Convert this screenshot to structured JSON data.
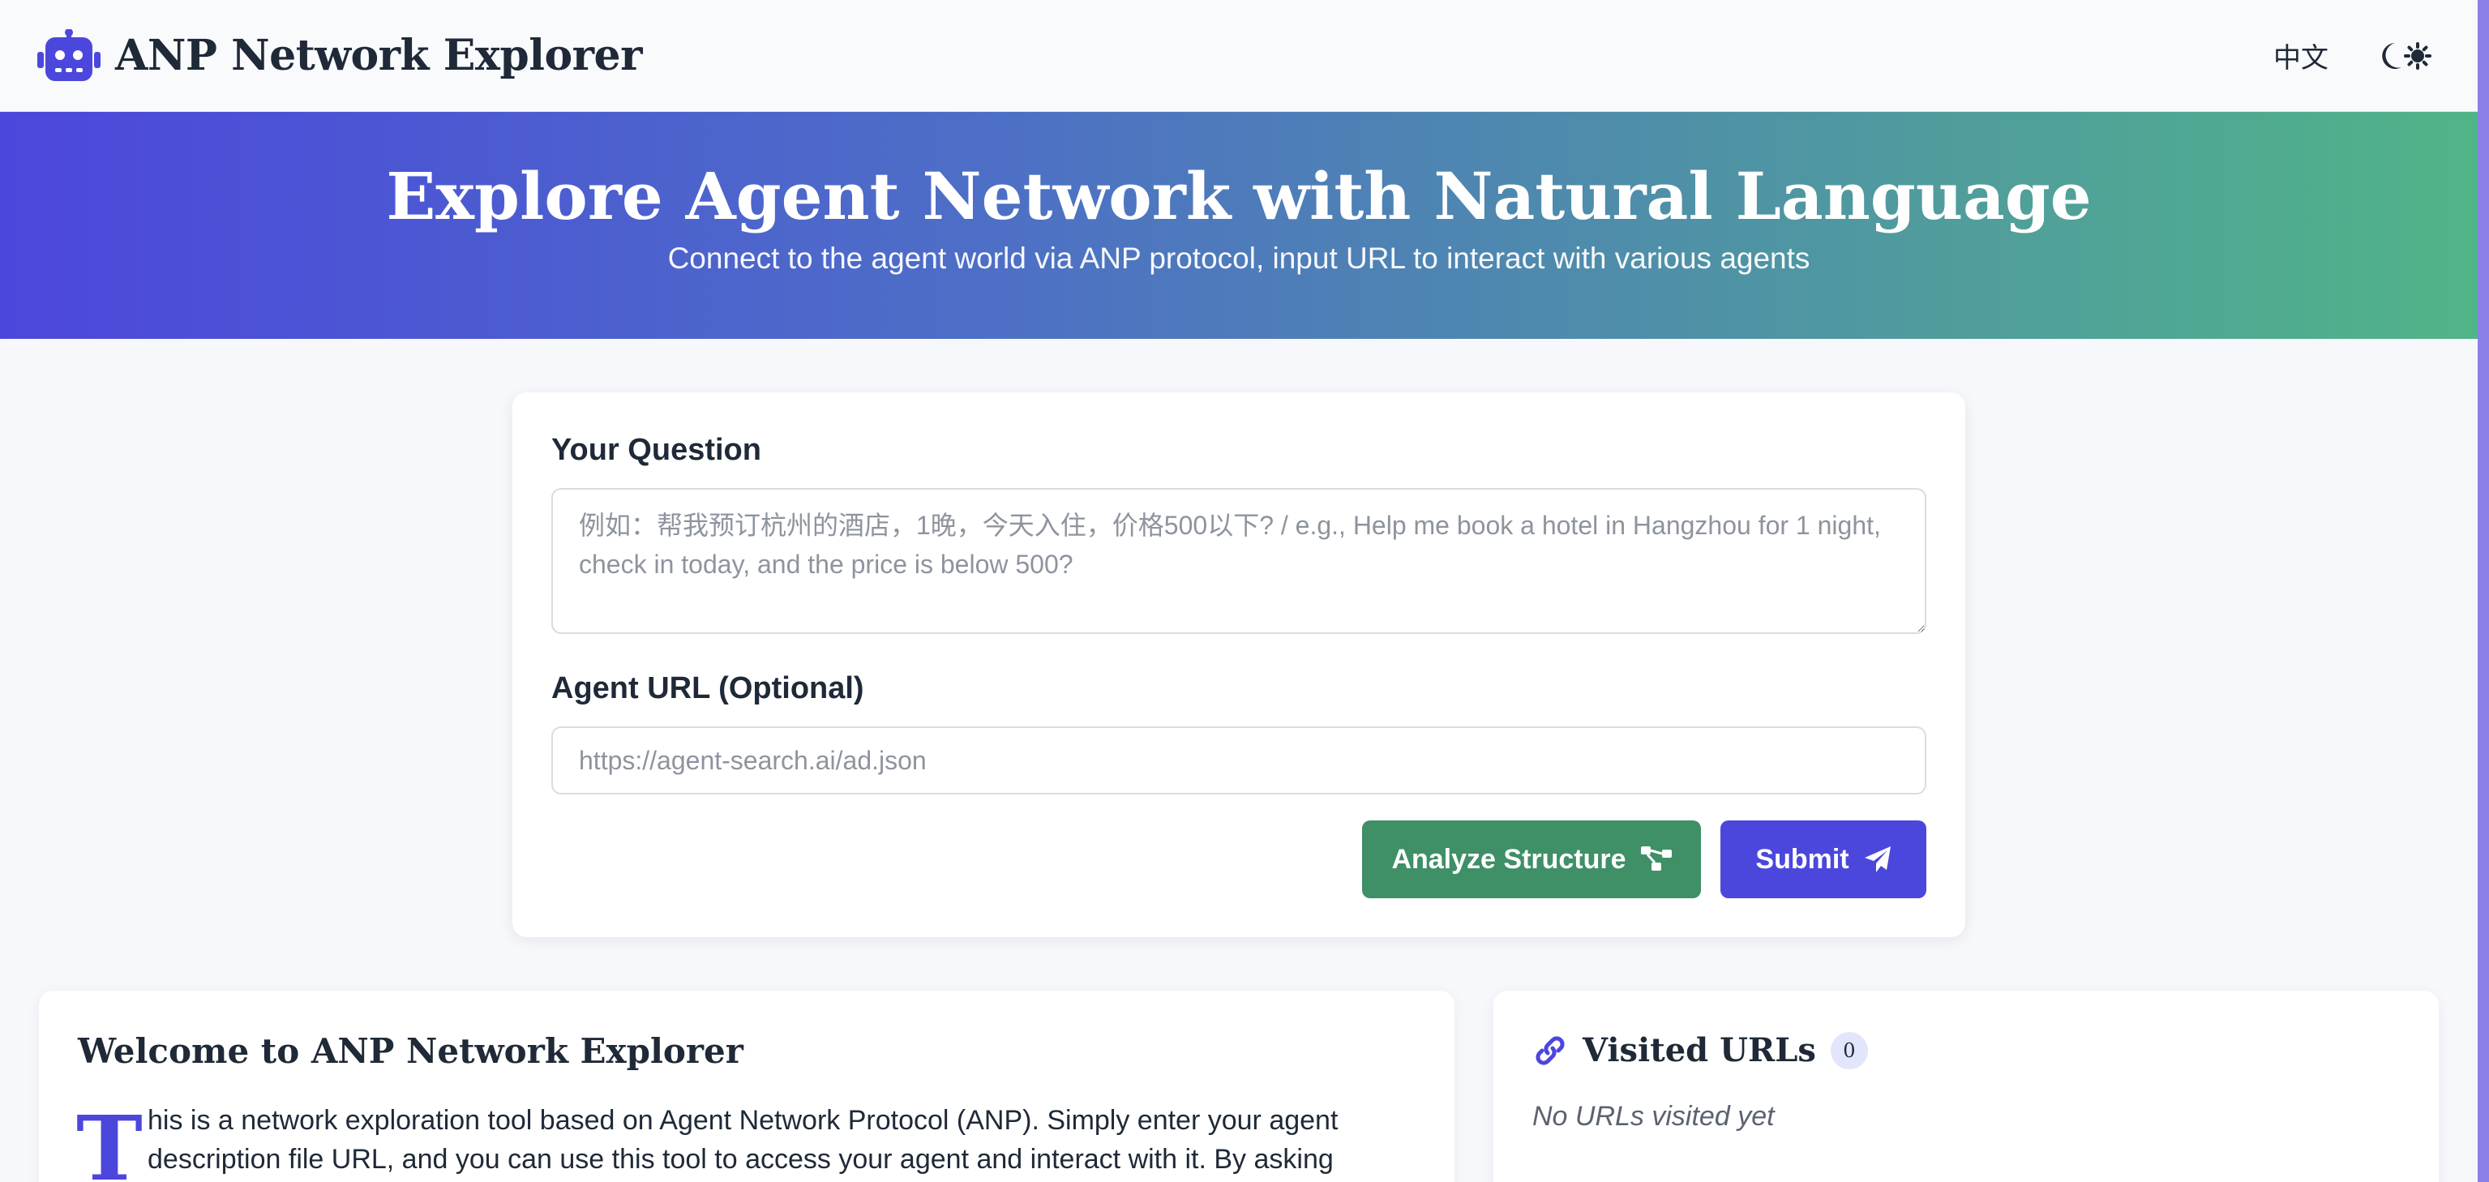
{
  "header": {
    "title": "ANP Network Explorer",
    "language_toggle": "中文",
    "brand_icon": "robot-icon",
    "theme_icons": [
      "moon-icon",
      "sun-icon"
    ]
  },
  "hero": {
    "title": "Explore Agent Network with Natural Language",
    "subtitle": "Connect to the agent world via ANP protocol, input URL to interact with various agents"
  },
  "form": {
    "question_label": "Your Question",
    "question_value": "",
    "question_placeholder": "例如：帮我预订杭州的酒店，1晚，今天入住，价格500以下? / e.g., Help me book a hotel in Hangzhou for 1 night, check in today, and the price is below 500?",
    "url_label": "Agent URL (Optional)",
    "url_value": "",
    "url_placeholder": "https://agent-search.ai/ad.json",
    "analyze_label": "Analyze Structure",
    "analyze_icon": "sitemap-icon",
    "submit_label": "Submit",
    "submit_icon": "paper-plane-icon"
  },
  "welcome": {
    "title": "Welcome to ANP Network Explorer",
    "dropcap": "T",
    "text": "his is a network exploration tool based on Agent Network Protocol (ANP). Simply enter your agent description file URL, and you can use this tool to access your agent and interact with it. By asking"
  },
  "visited": {
    "title": "Visited URLs",
    "count": "0",
    "empty_text": "No URLs visited yet",
    "icon": "link-icon"
  },
  "colors": {
    "accent": "#4c47dc",
    "analyze_button": "#3f8f67",
    "hero_gradient_start": "#4c47dc",
    "hero_gradient_end": "#51b488"
  }
}
